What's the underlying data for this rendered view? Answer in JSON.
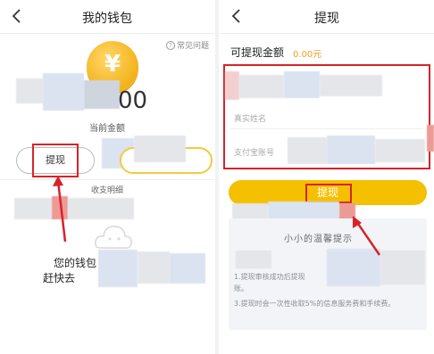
{
  "left": {
    "title": "我的钱包",
    "help": "常见问题",
    "coin_symbol": "¥",
    "amount_visible": "00",
    "amount_label": "当前金额",
    "withdraw_button": "提现",
    "detail_label": "收支明细",
    "empty_line1": "您的钱包",
    "empty_line2": "赶快去"
  },
  "right": {
    "title": "提现",
    "available_label": "可提现金额",
    "available_value": "0.00元",
    "name_placeholder": "真实姓名",
    "alipay_placeholder": "支付宝账号",
    "submit_button": "提现",
    "tips_title": "小小的温馨提示",
    "tip1a": "1.提现审核成功后提现",
    "tip1b": "账。",
    "tip3": "3.提现时会一次性收取5%的信息服务费和手续费。"
  },
  "colors": {
    "accent_yellow": "#f5c000",
    "amount_orange": "#f0a020",
    "highlight_red": "#d6232a"
  }
}
